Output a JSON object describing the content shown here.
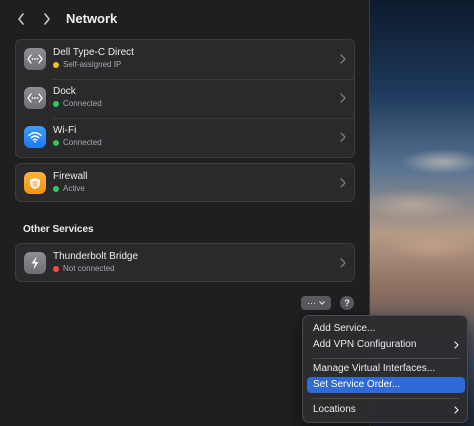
{
  "window": {
    "title": "Network"
  },
  "services": [
    {
      "name": "Dell Type-C Direct",
      "status": "Self-assigned IP",
      "status_color": "#f2c11a",
      "icon": "ethernet-icon"
    },
    {
      "name": "Dock",
      "status": "Connected",
      "status_color": "#32c759",
      "icon": "ethernet-icon"
    },
    {
      "name": "Wi-Fi",
      "status": "Connected",
      "status_color": "#32c759",
      "icon": "wifi-icon"
    }
  ],
  "firewall": {
    "name": "Firewall",
    "status": "Active",
    "status_color": "#32c759",
    "icon": "firewall-icon"
  },
  "other_services": {
    "title": "Other Services",
    "items": [
      {
        "name": "Thunderbolt Bridge",
        "status": "Not connected",
        "status_color": "#ff453a",
        "icon": "thunderbolt-icon"
      }
    ]
  },
  "actions": {
    "more_label": "···",
    "help_label": "?"
  },
  "menu": {
    "items": [
      {
        "label": "Add Service...",
        "submenu": false,
        "selected": false
      },
      {
        "label": "Add VPN Configuration",
        "submenu": true,
        "selected": false
      },
      {
        "label": "Manage Virtual Interfaces...",
        "submenu": false,
        "selected": false
      },
      {
        "label": "Set Service Order...",
        "submenu": false,
        "selected": true
      },
      {
        "label": "Locations",
        "submenu": true,
        "selected": false
      }
    ]
  },
  "colors": {
    "accent": "#2f6ad6",
    "connected": "#32c759",
    "warning": "#f2c11a",
    "error": "#ff453a"
  }
}
